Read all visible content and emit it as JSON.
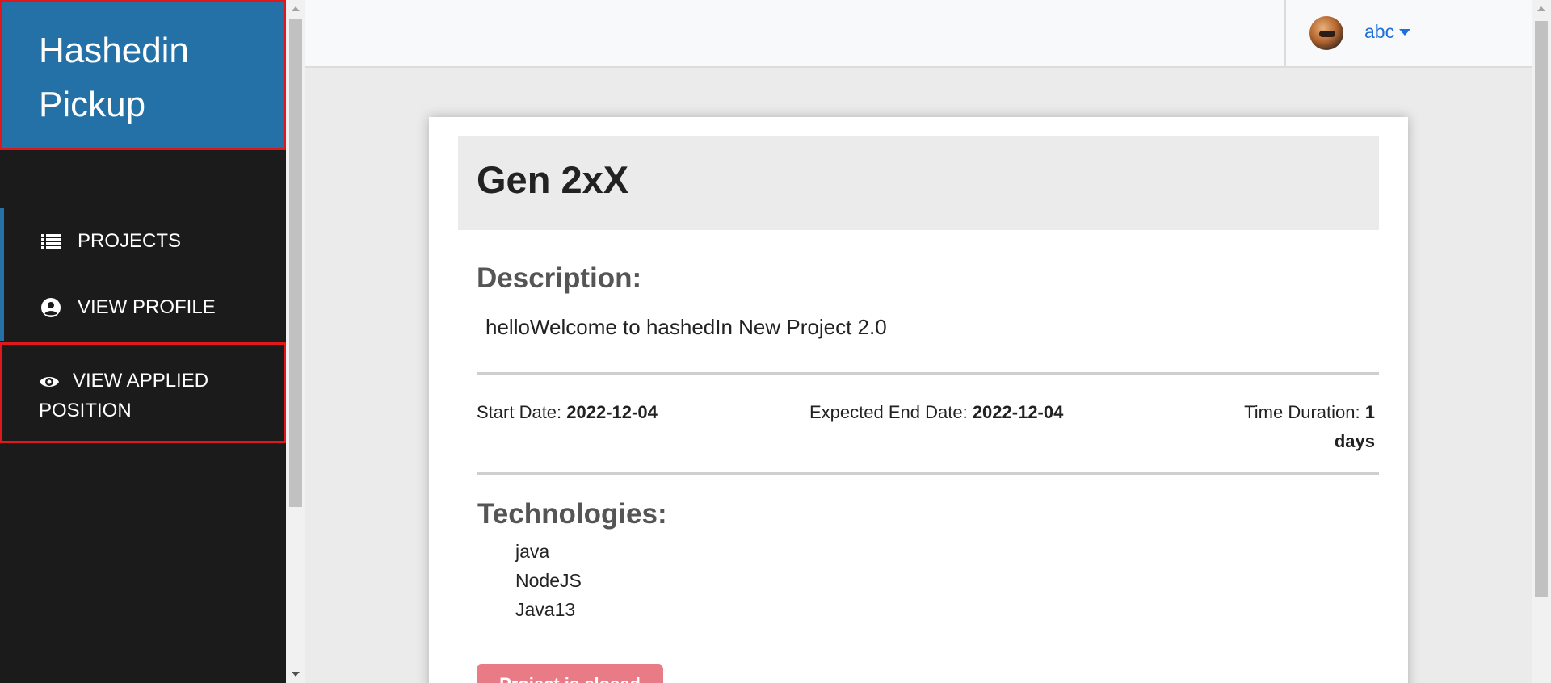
{
  "sidebar": {
    "brand": "Hashedin Pickup",
    "items": [
      {
        "label": "PROJECTS",
        "icon": "list-icon"
      },
      {
        "label": "VIEW PROFILE",
        "icon": "user-circle-icon"
      },
      {
        "label": "VIEW APPLIED POSITION",
        "icon": "eye-icon"
      }
    ]
  },
  "topbar": {
    "username": "abc"
  },
  "project": {
    "title": "Gen 2xX",
    "description_heading": "Description:",
    "description": "helloWelcome to hashedIn New Project 2.0",
    "start_label": "Start Date:",
    "start_value": "2022-12-04",
    "end_label": "Expected End Date:",
    "end_value": "2022-12-04",
    "duration_label": "Time Duration:",
    "duration_value": "1 days",
    "technologies_heading": "Technologies:",
    "technologies": [
      "java",
      "NodeJS",
      "Java13"
    ],
    "button_label": "Project is closed"
  },
  "colors": {
    "brand": "#2471a8",
    "sidebar_bg": "#1b1b1b",
    "highlight_border": "#e0181b",
    "link": "#1e6fd9",
    "button": "#e97b87"
  }
}
